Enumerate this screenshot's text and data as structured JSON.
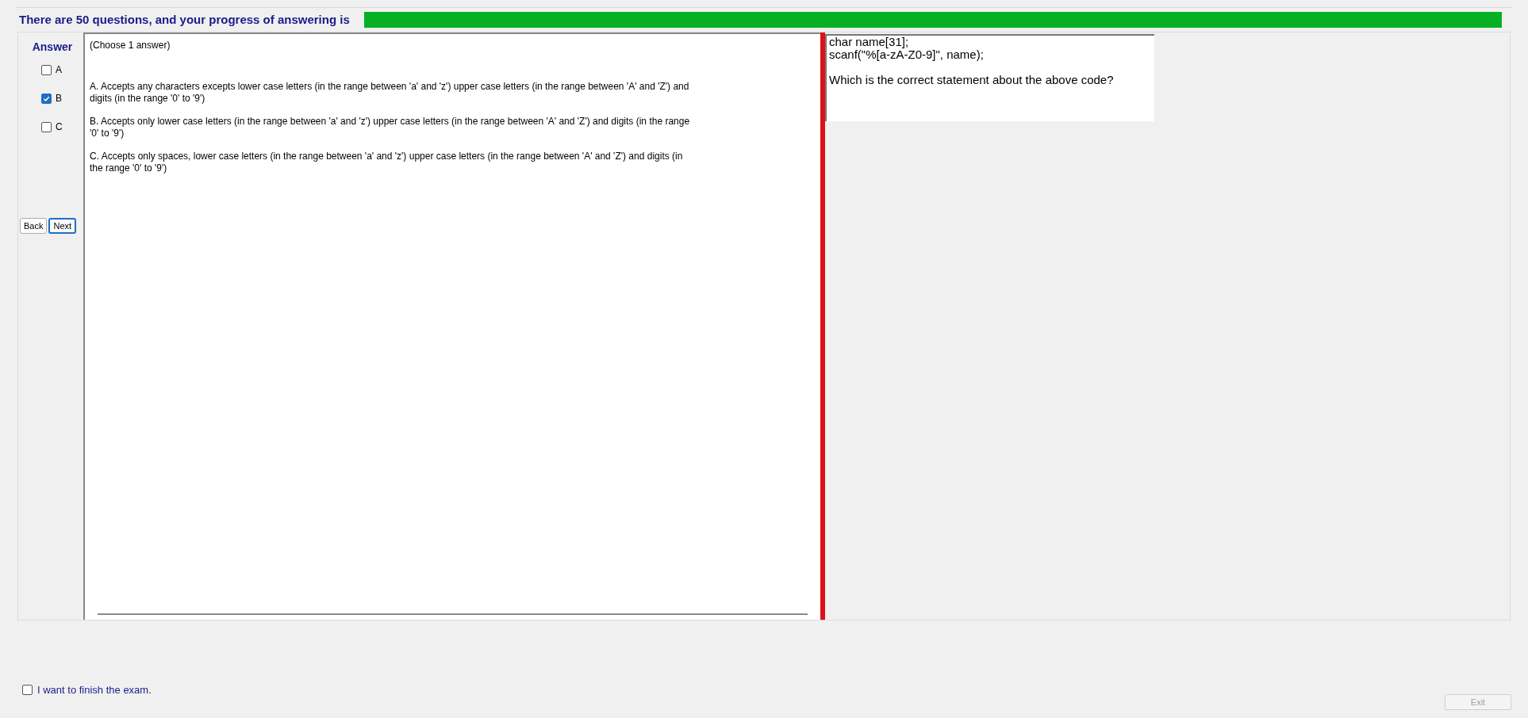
{
  "header": {
    "text": "There are 50 questions, and your progress of answering is",
    "progress": {
      "level": 1
    }
  },
  "answer_panel": {
    "title": "Answer",
    "options": [
      {
        "label": "A",
        "checked": false
      },
      {
        "label": "B",
        "checked": true
      },
      {
        "label": "C",
        "checked": false
      }
    ],
    "buttons": [
      {
        "label": "Back",
        "selected": false
      },
      {
        "label": "Next",
        "selected": true
      }
    ]
  },
  "answers_pane": {
    "instruction": "(Choose 1 answer)",
    "choices": [
      "A. Accepts any characters excepts lower case letters (in the range between 'a' and 'z') upper case letters (in the range between 'A' and 'Z') and digits (in the range '0' to '9')",
      "B. Accepts only lower case letters (in the range between 'a' and 'z') upper case letters (in the range between 'A' and 'Z') and digits (in the range '0' to '9')",
      "C. Accepts only spaces, lower case letters (in the range between 'a' and 'z') upper case letters (in the range between 'A' and 'Z') and digits (in the range '0' to '9')"
    ]
  },
  "question_pane": {
    "code_lines": [
      "char name[31];",
      "scanf(\"%[a-zA-Z0-9]\", name);"
    ],
    "question": "Which is the correct statement about the above code?"
  },
  "finish": {
    "label": "I want to finish the exam.",
    "checked": false
  },
  "exit_button": {
    "label": "Exit",
    "disabled": true
  }
}
